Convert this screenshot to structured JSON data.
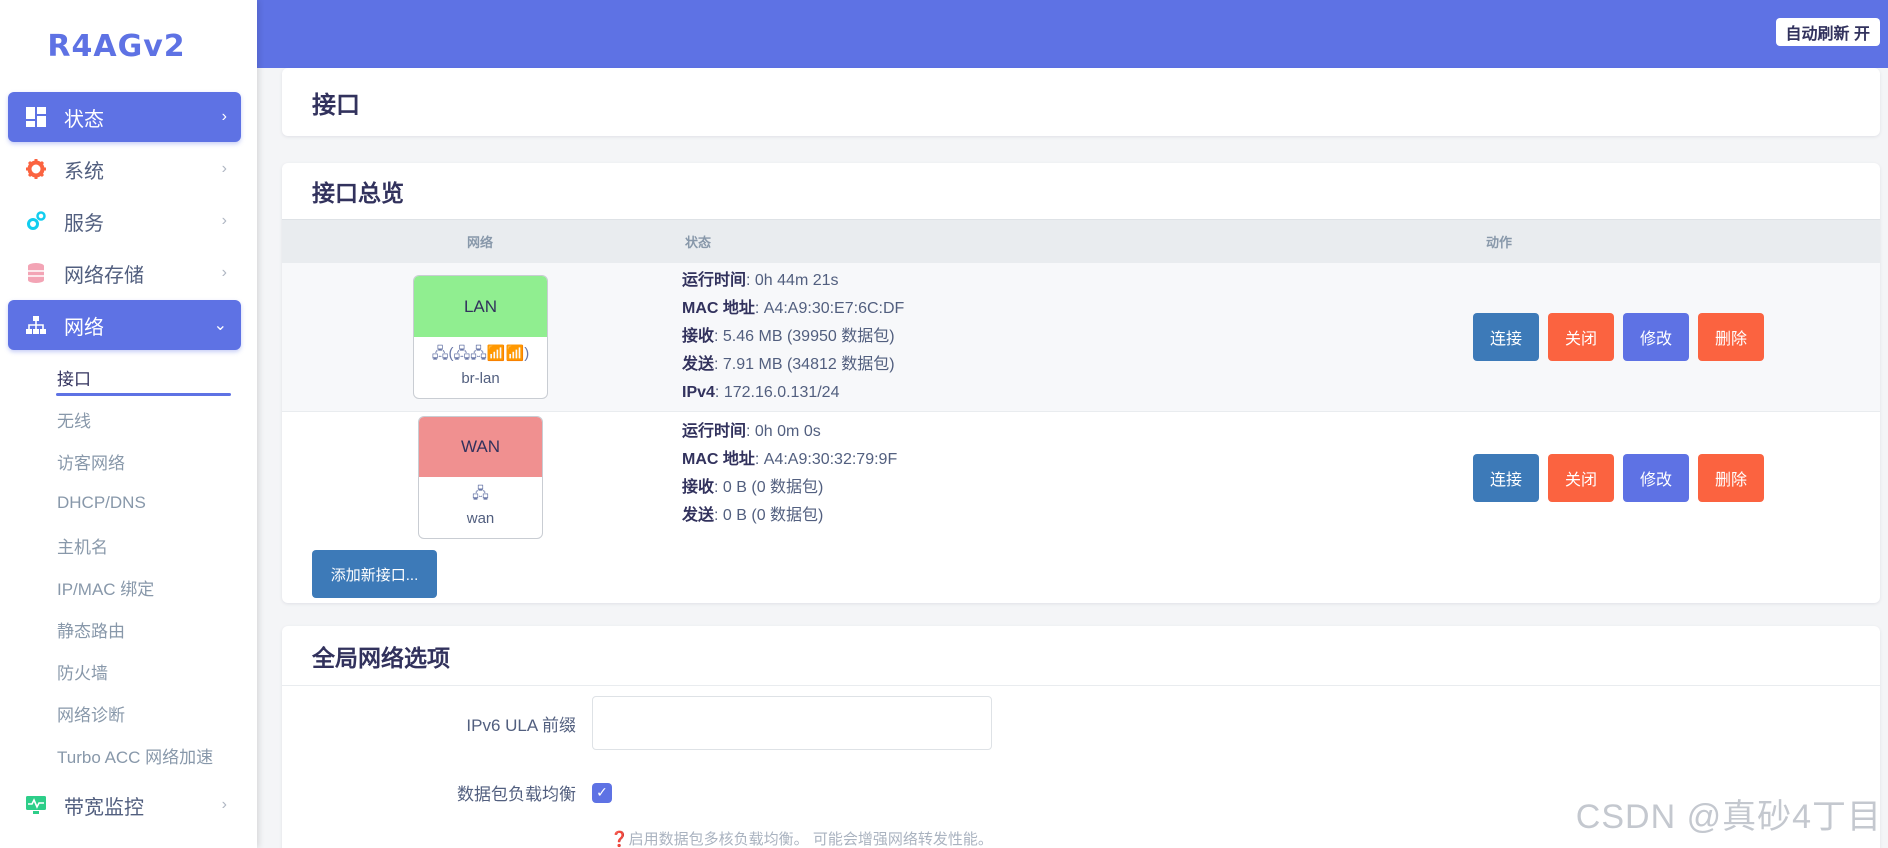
{
  "brand": "R4AGv2",
  "topbar": {
    "refresh_label": "自动刷新 开"
  },
  "sidebar": {
    "items": [
      {
        "label": "状态",
        "arrow": "›",
        "active": true
      },
      {
        "label": "系统",
        "arrow": "›"
      },
      {
        "label": "服务",
        "arrow": "›"
      },
      {
        "label": "网络存储",
        "arrow": "›"
      },
      {
        "label": "网络",
        "arrow": "⌄",
        "active": true
      },
      {
        "label": "带宽监控",
        "arrow": "›"
      }
    ],
    "network_sub": [
      "接口",
      "无线",
      "访客网络",
      "DHCP/DNS",
      "主机名",
      "IP/MAC 绑定",
      "静态路由",
      "防火墙",
      "网络诊断",
      "Turbo ACC 网络加速"
    ]
  },
  "page": {
    "title": "接口"
  },
  "overview": {
    "heading": "接口总览",
    "columns": {
      "network": "网络",
      "status": "状态",
      "action": "动作"
    },
    "interfaces": [
      {
        "name": "LAN",
        "color": "#90ee90",
        "icons": "🖧(🖧🖧📶📶)",
        "device": "br-lan",
        "status": [
          {
            "key": "运行时间",
            "value": "0h 44m 21s"
          },
          {
            "key": "MAC 地址",
            "value": "A4:A9:30:E7:6C:DF"
          },
          {
            "key": "接收",
            "value": "5.46 MB (39950 数据包)"
          },
          {
            "key": "发送",
            "value": "7.91 MB (34812 数据包)"
          },
          {
            "key": "IPv4",
            "value": "172.16.0.131/24"
          }
        ]
      },
      {
        "name": "WAN",
        "color": "#f09090",
        "icons": "🖧",
        "device": "wan",
        "status": [
          {
            "key": "运行时间",
            "value": "0h 0m 0s"
          },
          {
            "key": "MAC 地址",
            "value": "A4:A9:30:32:79:9F"
          },
          {
            "key": "接收",
            "value": "0 B (0 数据包)"
          },
          {
            "key": "发送",
            "value": "0 B (0 数据包)"
          }
        ]
      }
    ],
    "buttons": {
      "connect": "连接",
      "close": "关闭",
      "edit": "修改",
      "delete": "删除"
    },
    "add_label": "添加新接口..."
  },
  "global": {
    "heading": "全局网络选项",
    "ula_label": "IPv6 ULA 前缀",
    "ula_value": "",
    "balance_label": "数据包负载均衡",
    "balance_checked": "✓",
    "hint": "❓启用数据包多核负载均衡。 可能会增强网络转发性能。"
  },
  "watermark": "CSDN @真砂4丁目"
}
